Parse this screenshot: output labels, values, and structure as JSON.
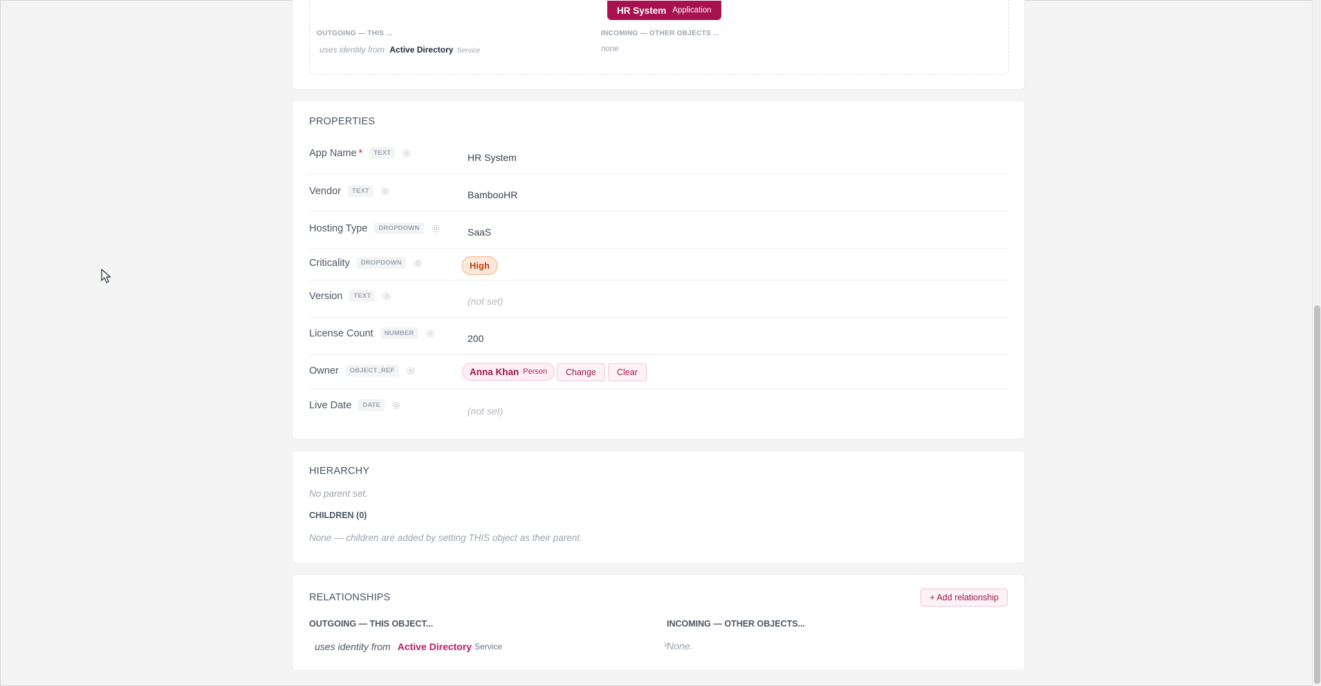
{
  "graph": {
    "node_name": "HR System",
    "node_type": "Application",
    "outgoing_label": "OUTGOING — THIS ...",
    "incoming_label": "INCOMING — OTHER OBJECTS ...",
    "outgoing_verb": "uses identity from",
    "outgoing_target": "Active Directory",
    "outgoing_target_type": "Service",
    "incoming_empty": "none"
  },
  "properties": {
    "title": "PROPERTIES",
    "rows": [
      {
        "label": "App Name",
        "required": "*",
        "type": "TEXT",
        "value": "HR System"
      },
      {
        "label": "Vendor",
        "type": "TEXT",
        "value": "BambooHR"
      },
      {
        "label": "Hosting Type",
        "type": "DROPDOWN",
        "value": "SaaS"
      },
      {
        "label": "Criticality",
        "type": "DROPDOWN",
        "value": "High"
      },
      {
        "label": "Version",
        "type": "TEXT",
        "value": "(not set)"
      },
      {
        "label": "License Count",
        "type": "NUMBER",
        "value": "200"
      },
      {
        "label": "Owner",
        "type": "OBJECT_REF",
        "ref_name": "Anna Khan",
        "ref_type": "Person",
        "change_label": "Change",
        "clear_label": "Clear"
      },
      {
        "label": "Live Date",
        "type": "DATE",
        "value": "(not set)"
      }
    ]
  },
  "hierarchy": {
    "title": "HIERARCHY",
    "parent_text": "No parent set.",
    "children_label": "CHILDREN (0)",
    "children_empty": "None — children are added by setting THIS object as their parent."
  },
  "relationships": {
    "title": "RELATIONSHIPS",
    "add_label": "+ Add relationship",
    "outgoing_label": "OUTGOING — THIS OBJECT...",
    "incoming_label": "INCOMING — OTHER OBJECTS...",
    "outgoing": [
      {
        "verb": "uses identity from",
        "target": "Active Directory",
        "target_type": "Service",
        "remove": "×"
      }
    ],
    "incoming_empty": "None."
  },
  "colors": {
    "brand": "#a8114f",
    "accent_text": "#be185d",
    "criticality_high": "#c2410c"
  }
}
